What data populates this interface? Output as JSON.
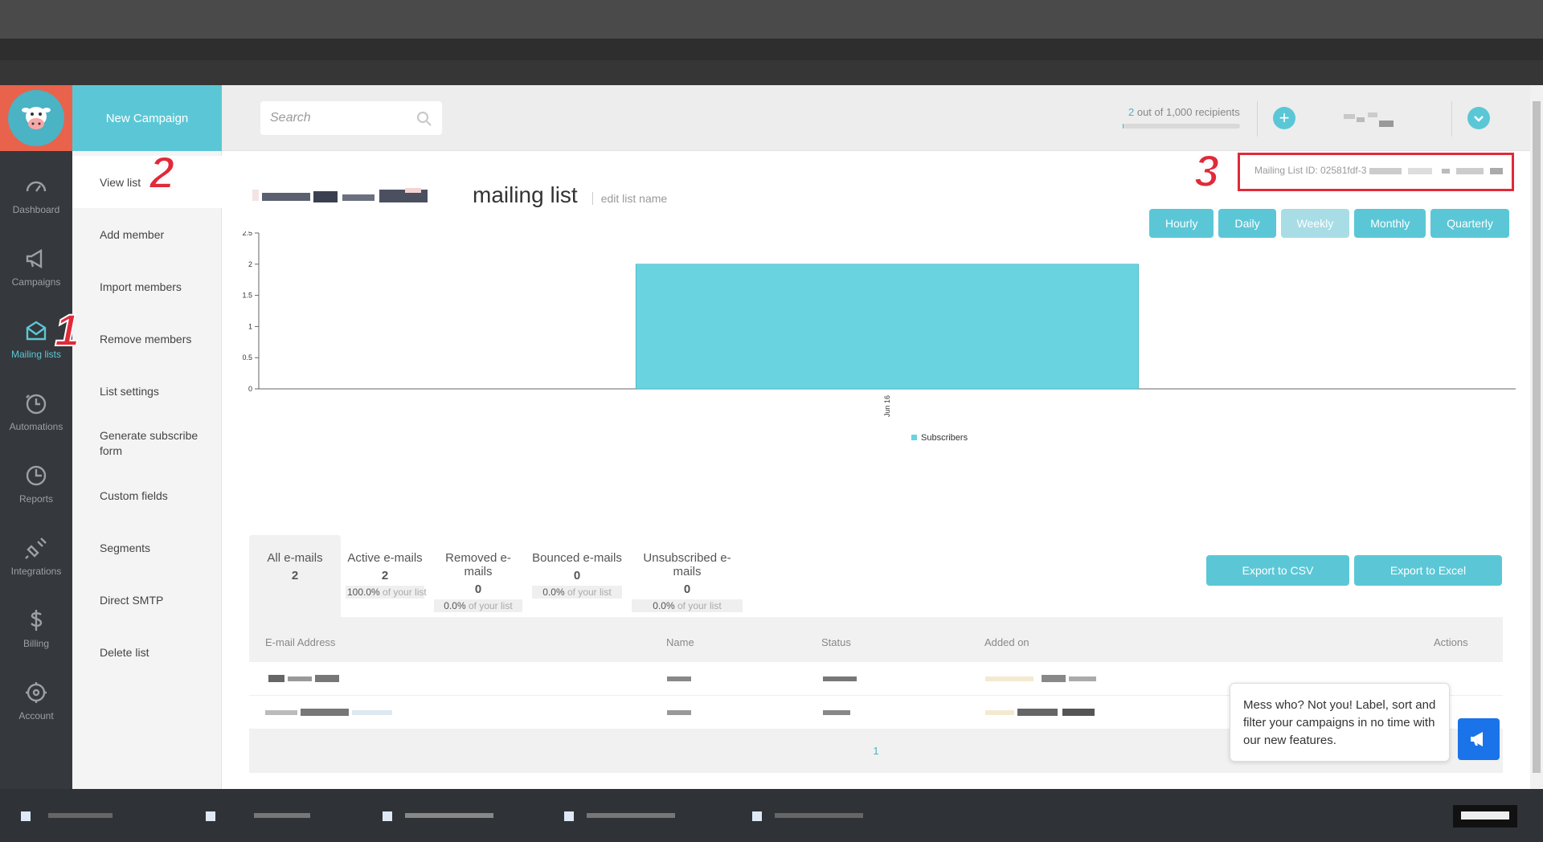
{
  "app": {
    "new_campaign_label": "New Campaign"
  },
  "rail": {
    "items": [
      {
        "label": "Dashboard",
        "icon": "gauge-icon"
      },
      {
        "label": "Campaigns",
        "icon": "megaphone-icon"
      },
      {
        "label": "Mailing lists",
        "icon": "envelope-icon"
      },
      {
        "label": "Automations",
        "icon": "timer-icon"
      },
      {
        "label": "Reports",
        "icon": "pie-clock-icon"
      },
      {
        "label": "Integrations",
        "icon": "plug-icon"
      },
      {
        "label": "Billing",
        "icon": "dollar-icon"
      },
      {
        "label": "Account",
        "icon": "gear-icon"
      }
    ],
    "active_index": 2
  },
  "submenu": {
    "items": [
      {
        "label": "View list"
      },
      {
        "label": "Add member"
      },
      {
        "label": "Import members"
      },
      {
        "label": "Remove members"
      },
      {
        "label": "List settings"
      },
      {
        "label": "Generate subscribe form"
      },
      {
        "label": "Custom fields"
      },
      {
        "label": "Segments"
      },
      {
        "label": "Direct SMTP"
      },
      {
        "label": "Delete list"
      }
    ],
    "active_index": 0
  },
  "topbar": {
    "search_placeholder": "Search",
    "recipients_count": "2",
    "recipients_text": " out of 1,000 recipients",
    "recipients_fraction": 0.002
  },
  "list": {
    "title": "mailing list",
    "edit_label": "edit list name",
    "id_label": "Mailing List ID: 02581fdf-3"
  },
  "annotations": [
    "1",
    "2",
    "3"
  ],
  "periods": [
    {
      "label": "Hourly",
      "selected": false
    },
    {
      "label": "Daily",
      "selected": false
    },
    {
      "label": "Weekly",
      "selected": true
    },
    {
      "label": "Monthly",
      "selected": false
    },
    {
      "label": "Quarterly",
      "selected": false
    }
  ],
  "chart_data": {
    "type": "bar",
    "categories": [
      "Jun 16"
    ],
    "series": [
      {
        "name": "Subscribers",
        "values": [
          2
        ]
      }
    ],
    "ylim": [
      0,
      2.5
    ],
    "yticks": [
      "0",
      "0.5",
      "1",
      "1.5",
      "2",
      "2.5"
    ],
    "xlabel": "",
    "ylabel": "",
    "legend": "bottom-center",
    "color": "#6ad3e0"
  },
  "tabs": [
    {
      "label": "All e-mails",
      "count": "2",
      "pct": "",
      "pct_suffix": ""
    },
    {
      "label": "Active e-mails",
      "count": "2",
      "pct": "100.0%",
      "pct_suffix": " of your list"
    },
    {
      "label": "Removed e-mails",
      "count": "0",
      "pct": "0.0%",
      "pct_suffix": " of your list"
    },
    {
      "label": "Bounced e-mails",
      "count": "0",
      "pct": "0.0%",
      "pct_suffix": " of your list"
    },
    {
      "label": "Unsubscribed e-mails",
      "count": "0",
      "pct": "0.0%",
      "pct_suffix": " of your list"
    }
  ],
  "exports": {
    "csv_label": "Export to CSV",
    "excel_label": "Export to Excel"
  },
  "table": {
    "headers": [
      "E-mail Address",
      "Name",
      "Status",
      "Added on",
      "Actions"
    ],
    "page": "1"
  },
  "chat": {
    "message": "Mess who? Not you! Label, sort and filter your campaigns in no time with our new features."
  },
  "colors": {
    "accent": "#5bc7d6",
    "logo_bg": "#e9624c",
    "rail_bg": "#35383c",
    "annotation": "#e02a3a"
  }
}
